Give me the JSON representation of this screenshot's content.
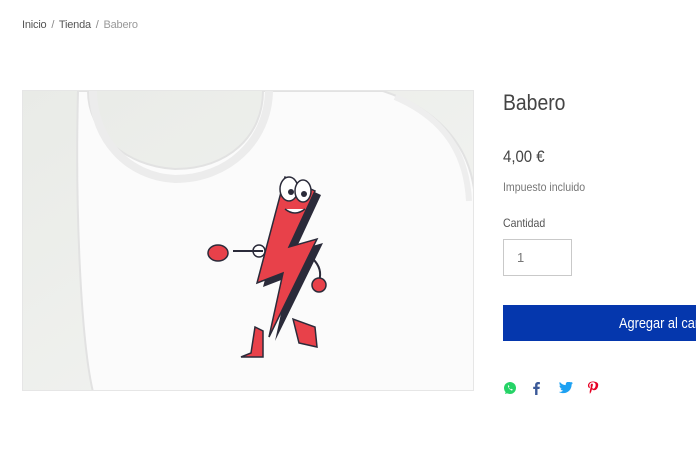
{
  "breadcrumb": {
    "home": "Inicio",
    "shop": "Tienda",
    "current": "Babero",
    "separator": "/"
  },
  "product": {
    "title": "Babero",
    "price": "4,00 €",
    "tax_note": "Impuesto incluido",
    "quantity_label": "Cantidad",
    "quantity_value": "1",
    "add_to_cart_label": "Agregar al carrito",
    "image_alt": "Babero blanco con personaje de rayo rojo"
  },
  "share": {
    "icons": [
      "whatsapp-icon",
      "facebook-icon",
      "twitter-icon",
      "pinterest-icon"
    ]
  },
  "colors": {
    "accent": "#0537ad",
    "whatsapp": "#25d366",
    "facebook": "#3b5998",
    "twitter": "#1da1f2",
    "pinterest": "#e60023",
    "bolt": "#e8414a"
  }
}
